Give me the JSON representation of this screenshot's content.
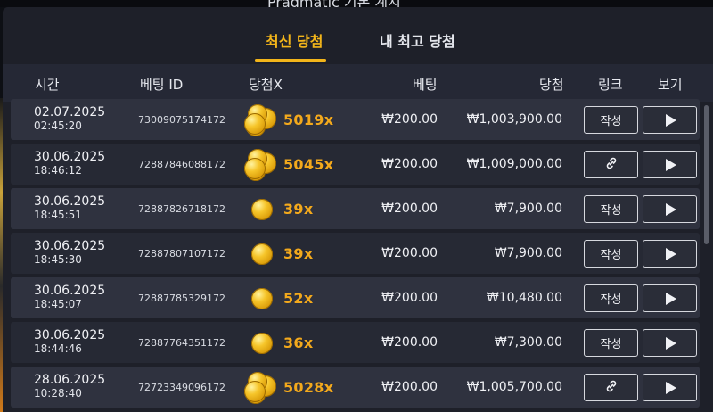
{
  "window": {
    "title": "Pragmatic 기본 계시"
  },
  "tabs": [
    {
      "label": "최신 당첨",
      "active": true
    },
    {
      "label": "내 최고 당첨",
      "active": false
    }
  ],
  "columns": {
    "time": "시간",
    "bet_id": "베팅 ID",
    "multiplier": "당첨X",
    "bet": "베팅",
    "win": "당첨",
    "link": "링크",
    "view": "보기"
  },
  "buttons": {
    "create_label": "작성"
  },
  "colors": {
    "accent": "#f3b51a",
    "multiplier": "#f3a91c",
    "panel": "#1e2029"
  },
  "rows": [
    {
      "date": "02.07.2025",
      "time": "02:45:20",
      "bet_id": "73009075174172",
      "coin": "stack",
      "multiplier": "5019x",
      "bet": "₩200.00",
      "win": "₩1,003,900.00",
      "link": "create"
    },
    {
      "date": "30.06.2025",
      "time": "18:46:12",
      "bet_id": "72887846088172",
      "coin": "stack",
      "multiplier": "5045x",
      "bet": "₩200.00",
      "win": "₩1,009,000.00",
      "link": "chain-icon"
    },
    {
      "date": "30.06.2025",
      "time": "18:45:51",
      "bet_id": "72887826718172",
      "coin": "single",
      "multiplier": "39x",
      "bet": "₩200.00",
      "win": "₩7,900.00",
      "link": "create"
    },
    {
      "date": "30.06.2025",
      "time": "18:45:30",
      "bet_id": "72887807107172",
      "coin": "single",
      "multiplier": "39x",
      "bet": "₩200.00",
      "win": "₩7,900.00",
      "link": "create"
    },
    {
      "date": "30.06.2025",
      "time": "18:45:07",
      "bet_id": "72887785329172",
      "coin": "single",
      "multiplier": "52x",
      "bet": "₩200.00",
      "win": "₩10,480.00",
      "link": "create"
    },
    {
      "date": "30.06.2025",
      "time": "18:44:46",
      "bet_id": "72887764351172",
      "coin": "single",
      "multiplier": "36x",
      "bet": "₩200.00",
      "win": "₩7,300.00",
      "link": "create"
    },
    {
      "date": "28.06.2025",
      "time": "10:28:40",
      "bet_id": "72723349096172",
      "coin": "stack",
      "multiplier": "5028x",
      "bet": "₩200.00",
      "win": "₩1,005,700.00",
      "link": "chain-icon"
    }
  ]
}
